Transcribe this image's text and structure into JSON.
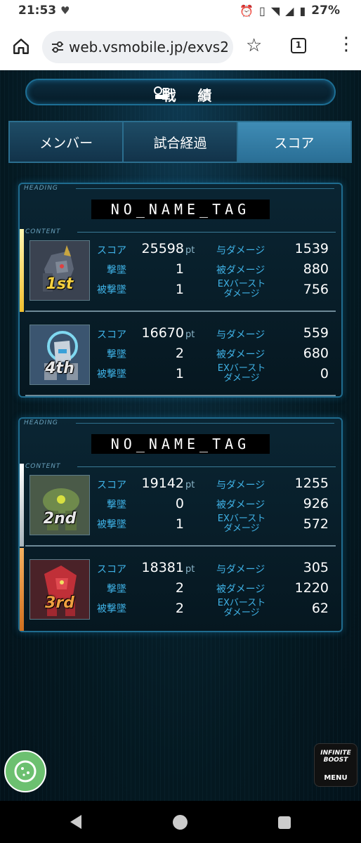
{
  "status_bar": {
    "time": "21:53",
    "battery": "27%"
  },
  "browser": {
    "url": "web.vsmobile.jp/exvs2",
    "tab_count": "1"
  },
  "page": {
    "title": "戦 績",
    "tabs": [
      {
        "label": "メンバー",
        "active": false
      },
      {
        "label": "試合経過",
        "active": false
      },
      {
        "label": "スコア",
        "active": true
      }
    ],
    "heading_label": "HEADING",
    "content_label": "CONTENT",
    "labels": {
      "score": "スコア",
      "shootdowns": "撃墜",
      "deaths": "被撃墜",
      "dealt": "与ダメージ",
      "taken": "被ダメージ",
      "exburst_1": "EXバースト",
      "exburst_2": "ダメージ",
      "pt": "pt"
    },
    "teams": [
      {
        "tag": "NO_NAME_TAG",
        "players": [
          {
            "rank": "1st",
            "score": "25598",
            "shootdowns": "1",
            "deaths": "1",
            "dealt": "1539",
            "taken": "880",
            "exburst": "756",
            "accent": "#f0d040"
          },
          {
            "rank": "4th",
            "score": "16670",
            "shootdowns": "2",
            "deaths": "1",
            "dealt": "559",
            "taken": "680",
            "exburst": "0",
            "accent": ""
          }
        ]
      },
      {
        "tag": "NO_NAME_TAG",
        "players": [
          {
            "rank": "2nd",
            "score": "19142",
            "shootdowns": "0",
            "deaths": "1",
            "dealt": "1255",
            "taken": "926",
            "exburst": "572",
            "accent": "#d8dde0"
          },
          {
            "rank": "3rd",
            "score": "18381",
            "shootdowns": "2",
            "deaths": "2",
            "dealt": "305",
            "taken": "1220",
            "exburst": "62",
            "accent": "#e08a30"
          }
        ]
      }
    ],
    "menu_button": {
      "label": "MENU",
      "logo": "INFINITE BOOST"
    }
  }
}
